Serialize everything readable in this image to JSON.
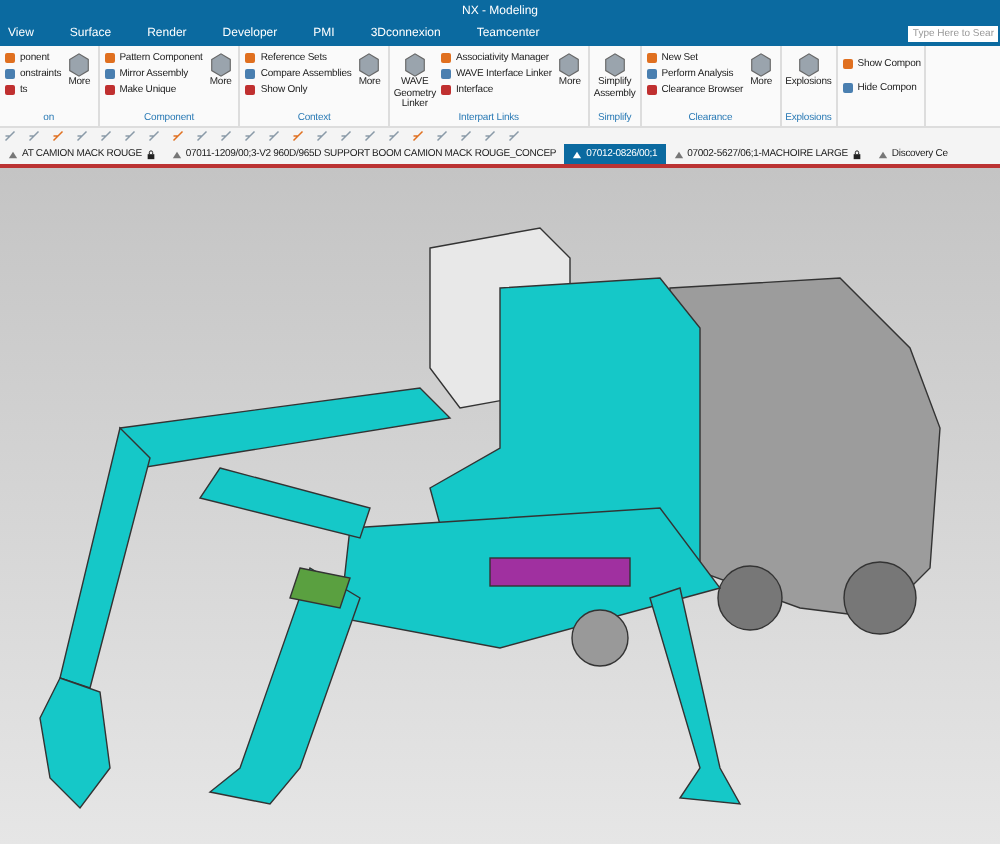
{
  "window": {
    "title": "NX - Modeling"
  },
  "menu_tabs": [
    "View",
    "Surface",
    "Render",
    "Developer",
    "PMI",
    "3Dconnexion",
    "Teamcenter"
  ],
  "search": {
    "placeholder": "Type Here to Sear"
  },
  "ribbon_groups": [
    {
      "label": "on",
      "items": [
        {
          "kind": "small",
          "label": "ponent"
        },
        {
          "kind": "small",
          "label": "onstraints"
        },
        {
          "kind": "small",
          "label": "ts"
        },
        {
          "kind": "large",
          "label": "More"
        }
      ]
    },
    {
      "label": "Component",
      "items": [
        {
          "kind": "small",
          "label": "Pattern Component"
        },
        {
          "kind": "small",
          "label": "Mirror Assembly"
        },
        {
          "kind": "small",
          "label": "Make Unique"
        },
        {
          "kind": "large",
          "label": "More"
        }
      ]
    },
    {
      "label": "Context",
      "items": [
        {
          "kind": "small",
          "label": "Reference Sets"
        },
        {
          "kind": "small",
          "label": "Compare Assemblies"
        },
        {
          "kind": "small",
          "label": "Show Only"
        },
        {
          "kind": "large",
          "label": "More"
        }
      ]
    },
    {
      "label": "Interpart Links",
      "items": [
        {
          "kind": "large",
          "label": "WAVE Geometry Linker"
        },
        {
          "kind": "small",
          "label": "Associativity Manager"
        },
        {
          "kind": "small",
          "label": "WAVE Interface Linker"
        },
        {
          "kind": "small",
          "label": "Interface"
        },
        {
          "kind": "large",
          "label": "More"
        }
      ]
    },
    {
      "label": "Simplify",
      "items": [
        {
          "kind": "large",
          "label": "Simplify Assembly"
        }
      ]
    },
    {
      "label": "Clearance",
      "items": [
        {
          "kind": "small",
          "label": "New Set"
        },
        {
          "kind": "small",
          "label": "Perform Analysis"
        },
        {
          "kind": "small",
          "label": "Clearance Browser"
        },
        {
          "kind": "large",
          "label": "More"
        }
      ]
    },
    {
      "label": "Explosions",
      "items": [
        {
          "kind": "large",
          "label": "Explosions"
        }
      ]
    },
    {
      "items": [
        {
          "kind": "medium",
          "label": "Show Compon"
        },
        {
          "kind": "medium",
          "label": "Hide Compon"
        }
      ]
    }
  ],
  "doc_tabs": [
    {
      "label": "AT CAMION MACK ROUGE",
      "selected": false,
      "locked": true
    },
    {
      "label": "07011-1209/00;3-V2 960D/965D SUPPORT BOOM CAMION MACK ROUGE_CONCEP",
      "selected": false,
      "locked": false
    },
    {
      "label": "07012-0826/00;1",
      "selected": true,
      "locked": false
    },
    {
      "label": "07002-5627/06;1-MACHOIRE LARGE",
      "selected": false,
      "locked": true
    },
    {
      "label": "Discovery Ce",
      "selected": false,
      "locked": false
    }
  ]
}
